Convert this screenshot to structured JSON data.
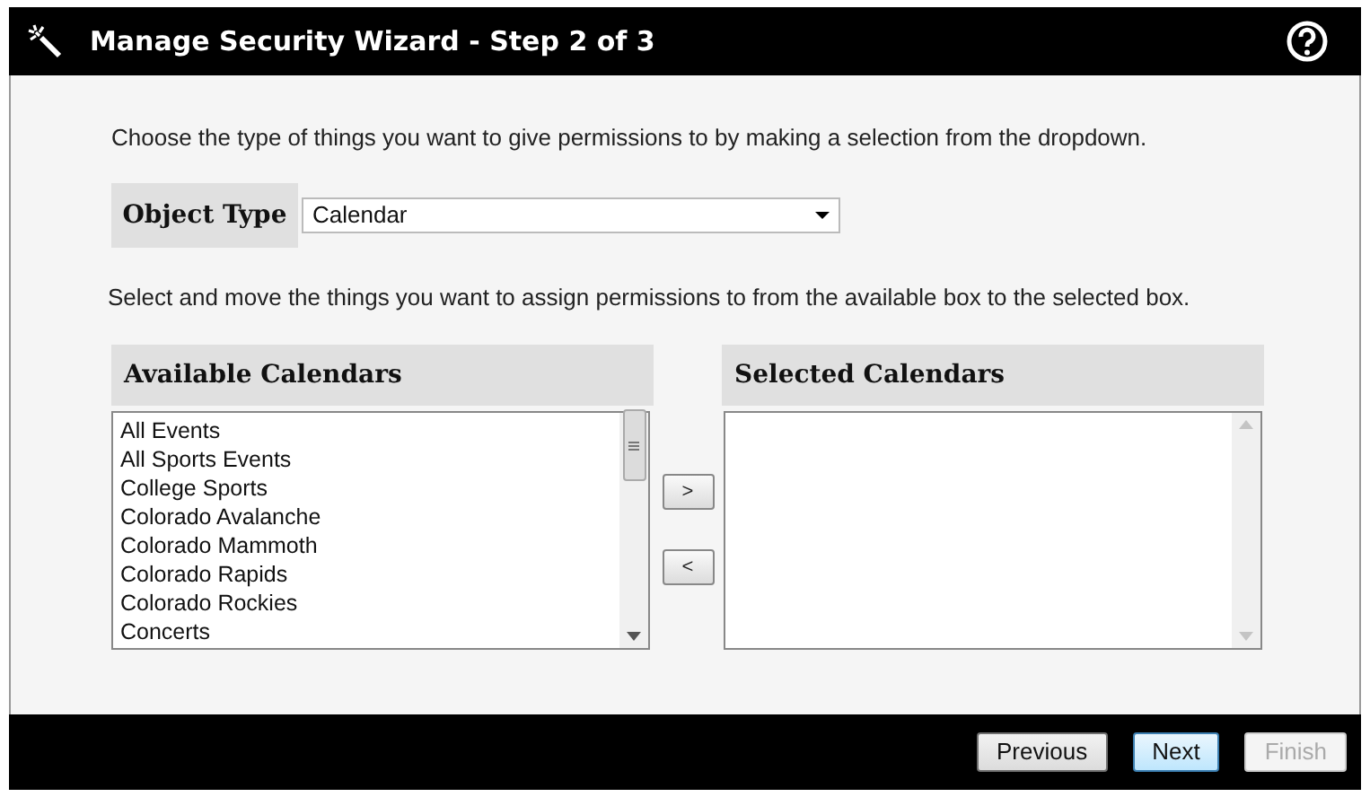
{
  "window": {
    "title": "Manage Security Wizard - Step 2 of 3"
  },
  "intro": "Choose the type of things you want to give permissions to by making a selection from the dropdown.",
  "object_type": {
    "label": "Object Type",
    "value": "Calendar"
  },
  "instructions": "Select and move the things you want to assign permissions to from the available box to the selected box.",
  "available": {
    "title": "Available Calendars",
    "items": [
      {
        "label": "All Events",
        "selected": false
      },
      {
        "label": "All Sports Events",
        "selected": false
      },
      {
        "label": "College Sports",
        "selected": false
      },
      {
        "label": "Colorado Avalanche",
        "selected": false
      },
      {
        "label": "Colorado Mammoth",
        "selected": false
      },
      {
        "label": "Colorado Rapids",
        "selected": false
      },
      {
        "label": "Colorado Rockies",
        "selected": false
      },
      {
        "label": "Concerts",
        "selected": false
      }
    ]
  },
  "move_buttons": [
    {
      "label": ">"
    },
    {
      "label": "<"
    }
  ],
  "selected_list": {
    "title": "Selected Calendars"
  },
  "footer_buttons": [
    {
      "label": "Previous",
      "focused": false,
      "disabled": false
    },
    {
      "label": "Next",
      "focused": true,
      "disabled": false
    },
    {
      "label": "Finish",
      "focused": false,
      "disabled": true
    }
  ]
}
